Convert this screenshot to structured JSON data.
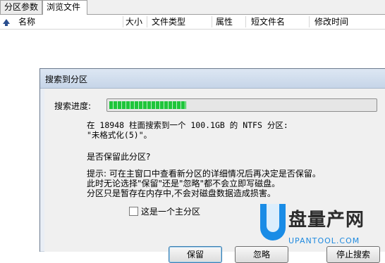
{
  "tabs": [
    {
      "label": "分区参数"
    },
    {
      "label": "浏览文件"
    }
  ],
  "columns": [
    {
      "label": "名称"
    },
    {
      "label": "大小"
    },
    {
      "label": "文件类型"
    },
    {
      "label": "属性"
    },
    {
      "label": "短文件名"
    },
    {
      "label": "修改时间"
    }
  ],
  "dialog": {
    "title": "搜索到分区",
    "progress_label": "搜索进度:",
    "progress_fraction": 0.29,
    "line1": "在 18948 柱面搜索到一个 100.1GB 的 NTFS 分区:",
    "line2": "\"未格式化(5)\"。",
    "question": "是否保留此分区?",
    "hint1": "提示: 可在主窗口中查看新分区的详细情况后再决定是否保留。",
    "hint2": "此时无论选择\"保留\"还是\"忽略\"都不会立即写磁盘。",
    "hint3": "分区只是暂存在内存中,不会对磁盘数据造成损害。",
    "checkbox_label": "这是一个主分区",
    "checkbox_checked": false,
    "buttons": {
      "keep": "保留",
      "ignore": "忽略",
      "stop": "停止搜索"
    }
  },
  "watermark": {
    "brand": "盘量产网",
    "url": "UPANTOOL.COM"
  },
  "colors": {
    "progress": "#1fc53b",
    "titlebar": "#c6d5e8",
    "watermark_blue": "#1a8ce6"
  }
}
